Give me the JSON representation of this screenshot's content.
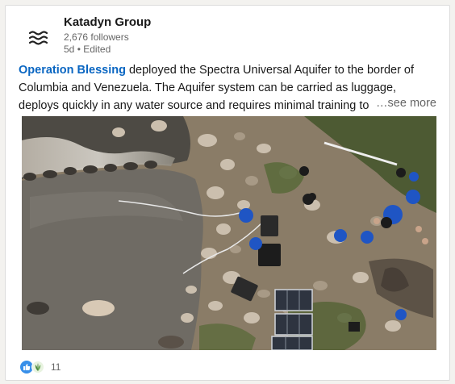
{
  "post": {
    "company": "Katadyn Group",
    "followers": "2,676 followers",
    "time": "5d",
    "edited": "Edited",
    "mention": "Operation Blessing",
    "text_line1_rest": " deployed the Spectra Universal Aquifer to the border of",
    "text_line2": "Columbia and Venezuela.  The Aquifer system can be carried as luggage,",
    "text_line3": "deploys quickly in any water source and requires minimal training to",
    "see_more": "…see more",
    "reaction_count": "11"
  },
  "icons": {
    "logo": "katadyn-waves-logo",
    "reaction_1": "like-icon",
    "reaction_2": "support-icon"
  },
  "colors": {
    "link": "#0a66c2",
    "like": "#378fe9",
    "muted": "#666666"
  }
}
